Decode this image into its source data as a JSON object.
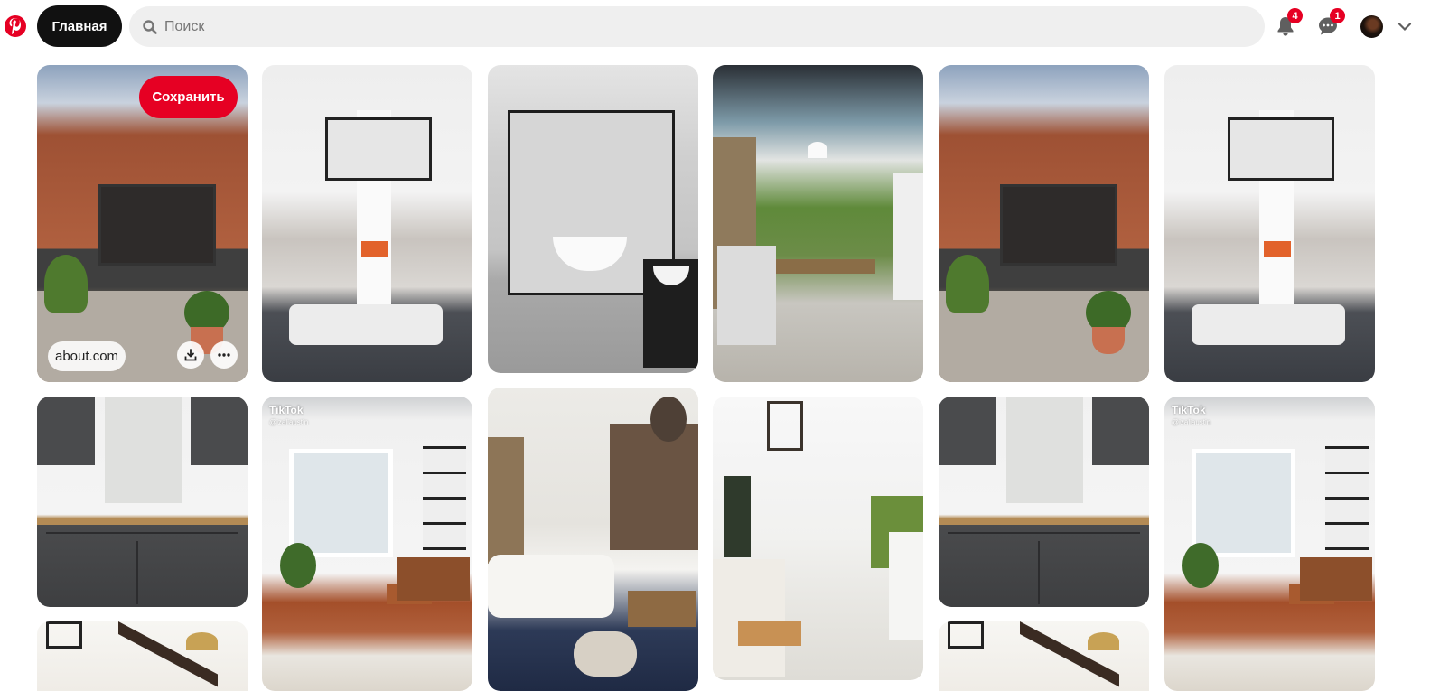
{
  "header": {
    "logo_icon": "pinterest-logo-icon",
    "home_label": "Главная",
    "search_placeholder": "Поиск",
    "notifications_count": "4",
    "messages_count": "1",
    "accent_color": "#e60023"
  },
  "pins": [
    {
      "scene": "Brick house extension with sliding glass doors and patio",
      "save_label": "Сохранить",
      "link_text": "about.com"
    },
    {
      "scene": "Double-height white living room with fireplace column"
    },
    {
      "scene": "Grey tiled bathroom with freestanding tub and glass shower"
    },
    {
      "scene": "Glass-roof conservatory dining area with banquette"
    },
    {
      "scene": "Brick house extension with sliding glass doors and patio"
    },
    {
      "scene": "Double-height white living room with fireplace column"
    },
    {
      "scene": "Dark grey kitchen cabinets with brass handles"
    },
    {
      "scene": "White living room with window, chair and gallery wall",
      "source_label": "TikTok",
      "handle": "@izaliaustin"
    },
    {
      "scene": "Cozy living room with chandelier, shelves and sofa"
    },
    {
      "scene": "White porch with wicker chairs and lantern"
    },
    {
      "scene": "Dark grey kitchen cabinets with brass handles"
    },
    {
      "scene": "White living room with window, chair and gallery wall",
      "source_label": "TikTok",
      "handle": "@izaliaustin"
    },
    {
      "scene": "Vaulted ceiling with dark beams and lamp"
    },
    {
      "scene": "Vaulted ceiling with dark beams and lamp"
    }
  ]
}
